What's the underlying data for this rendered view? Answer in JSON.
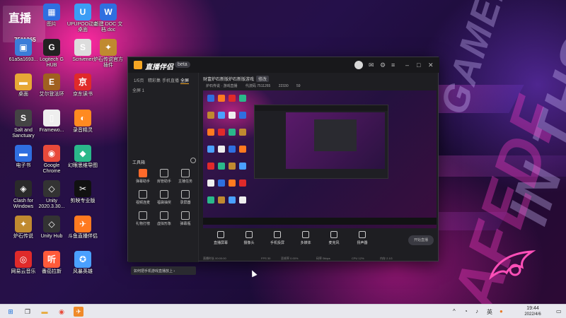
{
  "desktop": {
    "badge": {
      "top": "直播",
      "number": "7511265"
    },
    "icons": [
      {
        "label": "图片",
        "glyph": "▦",
        "color": "#2f6fe0"
      },
      {
        "label": "UPUPOO动态桌面",
        "glyph": "U",
        "color": "#3b9df5"
      },
      {
        "label": "新建 DOC 文档.doc",
        "glyph": "W",
        "color": "#2f6fe0"
      },
      {
        "label": "61a5a1693...",
        "glyph": "▣",
        "color": "#3b7dd8"
      },
      {
        "label": "Logitech G HUB",
        "glyph": "G",
        "color": "#222"
      },
      {
        "label": "Scrivener",
        "glyph": "S",
        "color": "#ddd"
      },
      {
        "label": "炉石传说官方插件",
        "glyph": "✦",
        "color": "#c08a30"
      },
      {
        "label": "桌面",
        "glyph": "▬",
        "color": "#e7a836"
      },
      {
        "label": "艾尔登法环",
        "glyph": "E",
        "color": "#a06020"
      },
      {
        "label": "京东读书",
        "glyph": "京",
        "color": "#e02a2a"
      },
      {
        "label": "Salt and Sanctuary",
        "glyph": "S",
        "color": "#444"
      },
      {
        "label": "Framewo...",
        "glyph": "▯",
        "color": "#eee"
      },
      {
        "label": "录音精灵",
        "glyph": "◐",
        "color": "#ff8a20"
      },
      {
        "label": "电子书",
        "glyph": "▬",
        "color": "#2f6fe0"
      },
      {
        "label": "Google Chrome",
        "glyph": "◉",
        "color": "#e84a3a"
      },
      {
        "label": "幻眼思维导图",
        "glyph": "◆",
        "color": "#2ab88a"
      },
      {
        "label": "Clash for Windows",
        "glyph": "◈",
        "color": "#2a2a2a"
      },
      {
        "label": "Unity 2020.3.30...",
        "glyph": "◇",
        "color": "#333"
      },
      {
        "label": "剪映专业版",
        "glyph": "✂",
        "color": "#111"
      },
      {
        "label": "炉石传说",
        "glyph": "✦",
        "color": "#c08a30"
      },
      {
        "label": "Unity Hub",
        "glyph": "◇",
        "color": "#333"
      },
      {
        "label": "斗鱼直播伴侣",
        "glyph": "✈",
        "color": "#ff7a20"
      },
      {
        "label": "网易云音乐",
        "glyph": "◎",
        "color": "#e02a2a"
      },
      {
        "label": "番茄拉新",
        "glyph": "听",
        "color": "#ff5a3a"
      },
      {
        "label": "风暴英雄",
        "glyph": "✪",
        "color": "#4aa0ff"
      }
    ]
  },
  "app": {
    "name": "直播伴侣",
    "version": "beta",
    "sidebar_tabs": [
      "1/5页",
      "精彩集",
      "手机直播",
      "全屏"
    ],
    "sidebar_row": "全屏 1",
    "tools_title": "工具箱",
    "tools": [
      "弹幕助手",
      "房管助手",
      "主播任务",
      "视频连麦",
      "福袋抽奖",
      "录屏器",
      "礼物打榜",
      "虚拟形象",
      "弹幕瓶"
    ],
    "sidebar_footer": "如何把手机游戏直播放上 ›",
    "stream_title": "财富炉石新版炉石新版游戏",
    "stream_tag": "修改",
    "meta": [
      "炉石传说 · 游戏直播",
      "代流码 7511265",
      "22330",
      "59"
    ],
    "bottom_buttons": [
      "直播屏幕",
      "摄像头",
      "手机投屏",
      "多媒体",
      "麦克风",
      "扬声器"
    ],
    "live_button": "开始直播",
    "status": [
      "直播时长 00:00:00",
      "FPS 30",
      "丢帧率 0.00%",
      "码率 0kbps",
      "CPU 12%",
      "内存 2.1G"
    ]
  },
  "taskbar": {
    "time": "19:44",
    "date": "2022/4/6"
  }
}
